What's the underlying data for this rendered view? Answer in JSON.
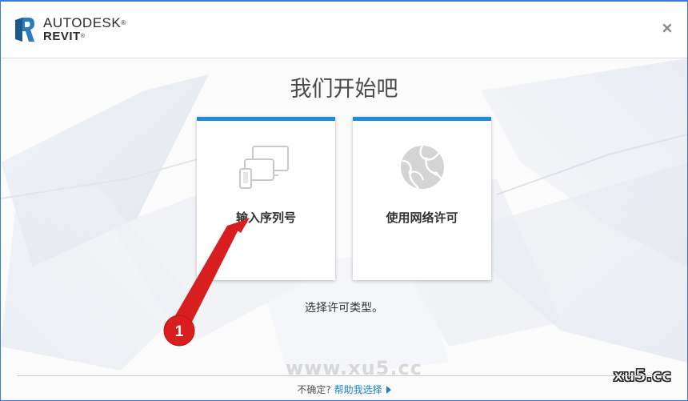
{
  "header": {
    "brand_line1": "AUTODESK",
    "brand_line2": "REVIT",
    "tm": "®",
    "close_icon": "close-icon"
  },
  "main": {
    "title": "我们开始吧",
    "cards": [
      {
        "label": "输入序列号",
        "icon": "devices-icon"
      },
      {
        "label": "使用网络许可",
        "icon": "globe-network-icon"
      }
    ],
    "subtitle": "选择许可类型。"
  },
  "annotation": {
    "badge_number": "1",
    "color": "#d81e1e"
  },
  "footer": {
    "question": "不确定?",
    "help_link": "帮助我选择"
  },
  "watermarks": {
    "center": "www.xu5.cc",
    "corner": "xu5.cc"
  },
  "colors": {
    "accent": "#1a8ed8",
    "link": "#1a7fd0",
    "annotation": "#d81e1e"
  }
}
